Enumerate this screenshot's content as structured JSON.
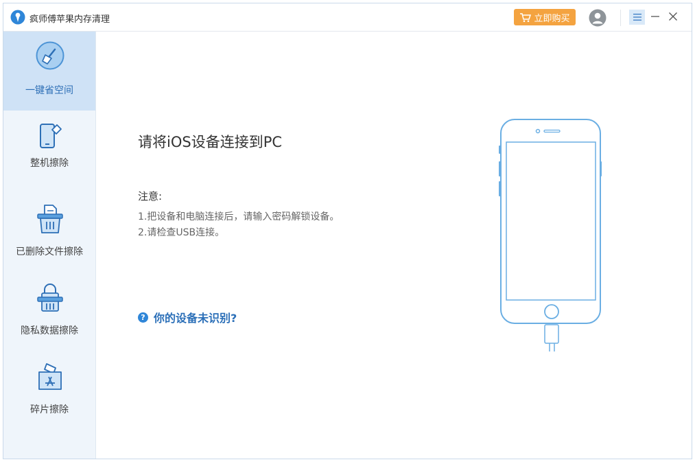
{
  "app": {
    "title": "疯师傅苹果内存清理",
    "buy_label": "立即购买"
  },
  "sidebar": {
    "items": [
      {
        "label": "一键省空间",
        "icon": "broom-icon",
        "active": true
      },
      {
        "label": "整机擦除",
        "icon": "phone-eraser-icon",
        "active": false
      },
      {
        "label": "已删除文件擦除",
        "icon": "trash-file-icon",
        "active": false
      },
      {
        "label": "隐私数据擦除",
        "icon": "privacy-lock-icon",
        "active": false
      },
      {
        "label": "碎片擦除",
        "icon": "fragment-appstore-icon",
        "active": false
      }
    ]
  },
  "main": {
    "title": "请将iOS设备连接到PC",
    "note_label": "注意:",
    "notes": [
      "1.把设备和电脑连接后，请输入密码解锁设备。",
      "2.请检查USB连接。"
    ],
    "help_icon_glyph": "?",
    "help_link": "你的设备未识别?"
  },
  "colors": {
    "accent": "#2d6fb6",
    "buy_button": "#f4a340",
    "sidebar_bg": "#eff5fb",
    "sidebar_active": "#cfe2f6",
    "phone_line": "#6aaee3"
  }
}
